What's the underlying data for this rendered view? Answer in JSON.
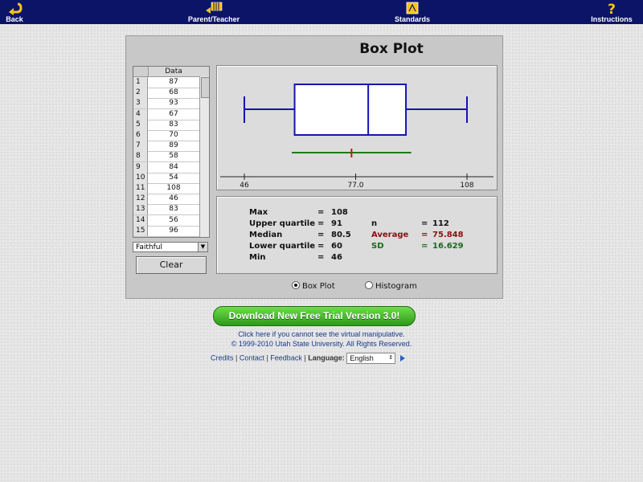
{
  "topbar": {
    "back_label": "Back",
    "parent_label": "Parent/Teacher",
    "standards_label": "Standards",
    "instructions_label": "Instructions"
  },
  "panel": {
    "title": "Box Plot",
    "table_header": "Data",
    "rows": [
      {
        "idx": "1",
        "val": "87"
      },
      {
        "idx": "2",
        "val": "68"
      },
      {
        "idx": "3",
        "val": "93"
      },
      {
        "idx": "4",
        "val": "67"
      },
      {
        "idx": "5",
        "val": "83"
      },
      {
        "idx": "6",
        "val": "70"
      },
      {
        "idx": "7",
        "val": "89"
      },
      {
        "idx": "8",
        "val": "58"
      },
      {
        "idx": "9",
        "val": "84"
      },
      {
        "idx": "10",
        "val": "54"
      },
      {
        "idx": "11",
        "val": "108"
      },
      {
        "idx": "12",
        "val": "46"
      },
      {
        "idx": "13",
        "val": "83"
      },
      {
        "idx": "14",
        "val": "56"
      },
      {
        "idx": "15",
        "val": "96"
      }
    ],
    "dataset": "Faithful",
    "clear_label": "Clear",
    "radio_boxplot": "Box Plot",
    "radio_histogram": "Histogram"
  },
  "plot": {
    "axis_ticks": [
      {
        "value": 46,
        "label": "46"
      },
      {
        "value": 77,
        "label": "77.0"
      },
      {
        "value": 108,
        "label": "108"
      }
    ],
    "min": 46,
    "q1": 60,
    "median": 80.5,
    "q3": 91,
    "max": 108,
    "mean": 75.848,
    "sd": 16.629,
    "colors": {
      "box": "#1414b4",
      "sd_line": "#1a7a1a",
      "mean_mark": "#d01010"
    }
  },
  "stats": {
    "max_label": "Max",
    "max_val": "108",
    "uq_label": "Upper quartile",
    "uq_val": "91",
    "median_label": "Median",
    "median_val": "80.5",
    "lq_label": "Lower quartile",
    "lq_val": "60",
    "min_label": "Min",
    "min_val": "46",
    "eq": "=",
    "n_label": "n",
    "n_val": "112",
    "avg_label": "Average",
    "avg_val": "75.848",
    "sd_label": "SD",
    "sd_val": "16.629"
  },
  "footer": {
    "download_label": "Download New Free Trial Version 3.0!",
    "help_text": "Click here if you cannot see the virtual manipulative.",
    "copyright": "© 1999-2010 Utah State University. All Rights Reserved.",
    "credits": "Credits",
    "contact": "Contact",
    "feedback": "Feedback",
    "sep": "|",
    "language_label": "Language:",
    "language_value": "English"
  }
}
